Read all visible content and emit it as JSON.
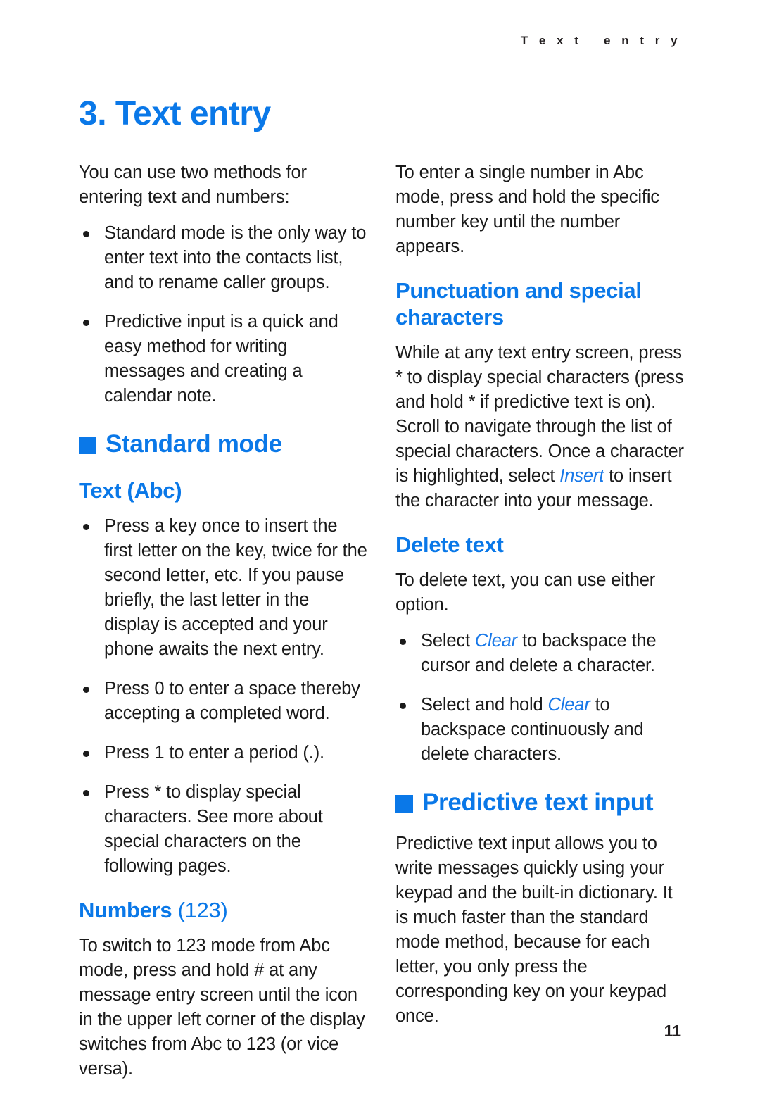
{
  "document": {
    "running_header": "T e x t   e n t r y",
    "chapter_title": "3. Text entry",
    "page_number": "11"
  },
  "left_column": {
    "intro": "You can use two methods for entering text and numbers:",
    "intro_bullets": [
      "Standard mode is the only way to enter text into the contacts list, and to rename caller groups.",
      "Predictive input is a quick and easy method for writing messages and creating a calendar note."
    ],
    "standard_mode_heading": "Standard mode",
    "text_abc_heading": "Text (Abc)",
    "text_abc_bullets": [
      "Press a key once to insert the first letter on the key, twice for the second letter, etc. If you pause briefly, the last letter in the display is accepted and your phone awaits the next entry.",
      "Press 0 to enter a space thereby accepting a completed word.",
      "Press 1 to enter a period (.).",
      "Press * to display special characters. See more about special characters on the following pages."
    ],
    "numbers_heading_bold": "Numbers",
    "numbers_heading_light": " (123)",
    "numbers_paragraph": "To switch to 123 mode from Abc mode, press and hold # at any message entry screen until the icon in the upper left corner of the display switches from Abc to 123 (or vice versa)."
  },
  "right_column": {
    "abc_number_paragraph": "To enter a single number in Abc mode, press and hold the specific number key until the number appears.",
    "punctuation_heading": "Punctuation and special characters",
    "punctuation_paragraph_part1": "While at any text entry screen, press * to display special characters (press and hold * if predictive text is on). Scroll to navigate through the list of special characters. Once a character is highlighted, select ",
    "punctuation_softkey": "Insert",
    "punctuation_paragraph_part2": " to insert the character into your message.",
    "delete_text_heading": "Delete text",
    "delete_text_paragraph": "To delete text, you can use either option.",
    "delete_bullet_1_part1": "Select ",
    "delete_bullet_1_softkey": "Clear",
    "delete_bullet_1_part2": " to backspace the cursor and delete a character.",
    "delete_bullet_2_part1": "Select and hold ",
    "delete_bullet_2_softkey": "Clear",
    "delete_bullet_2_part2": " to backspace continuously and delete characters.",
    "predictive_heading": "Predictive text input",
    "predictive_paragraph": "Predictive text input allows you to write messages quickly using your keypad and the built-in dictionary. It is much faster than the standard mode method, because for each letter, you only press the corresponding key on your keypad once."
  },
  "colors": {
    "accent_blue": "#0a78e8",
    "softkey_blue": "#1878e8",
    "body_text": "#1a1a1a",
    "page_background": "#ffffff"
  }
}
